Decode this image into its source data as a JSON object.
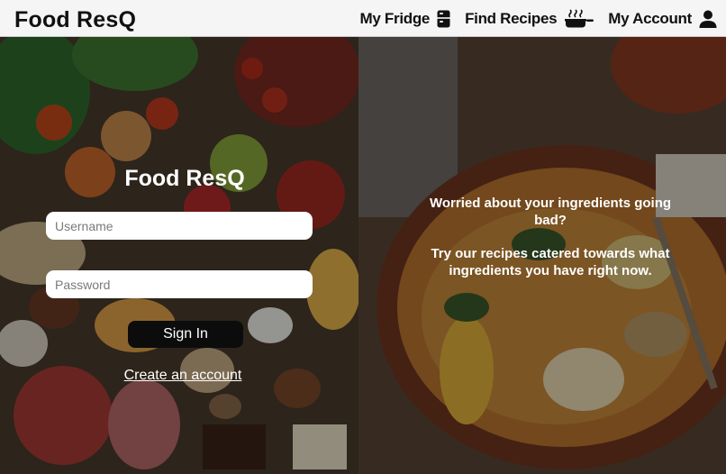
{
  "header": {
    "brand": "Food ResQ",
    "nav": [
      {
        "label": "My Fridge",
        "icon": "fridge-icon"
      },
      {
        "label": "Find Recipes",
        "icon": "cooking-pot-icon"
      },
      {
        "label": "My Account",
        "icon": "user-icon"
      }
    ]
  },
  "login": {
    "title": "Food ResQ",
    "username_placeholder": "Username",
    "password_placeholder": "Password",
    "sign_in_label": "Sign In",
    "create_account_label": "Create an account",
    "background": "vegetables-and-groceries-photo"
  },
  "promo": {
    "line1": "Worried about your ingredients going bad?",
    "line2": "Try our recipes catered towards what ingredients you have right now.",
    "background": "seafood-stew-bowl-photo"
  },
  "colors": {
    "topbar_bg": "#f5f5f5",
    "button_bg": "#0c0c0c",
    "text_light": "#ffffff",
    "text_dark": "#111111"
  }
}
